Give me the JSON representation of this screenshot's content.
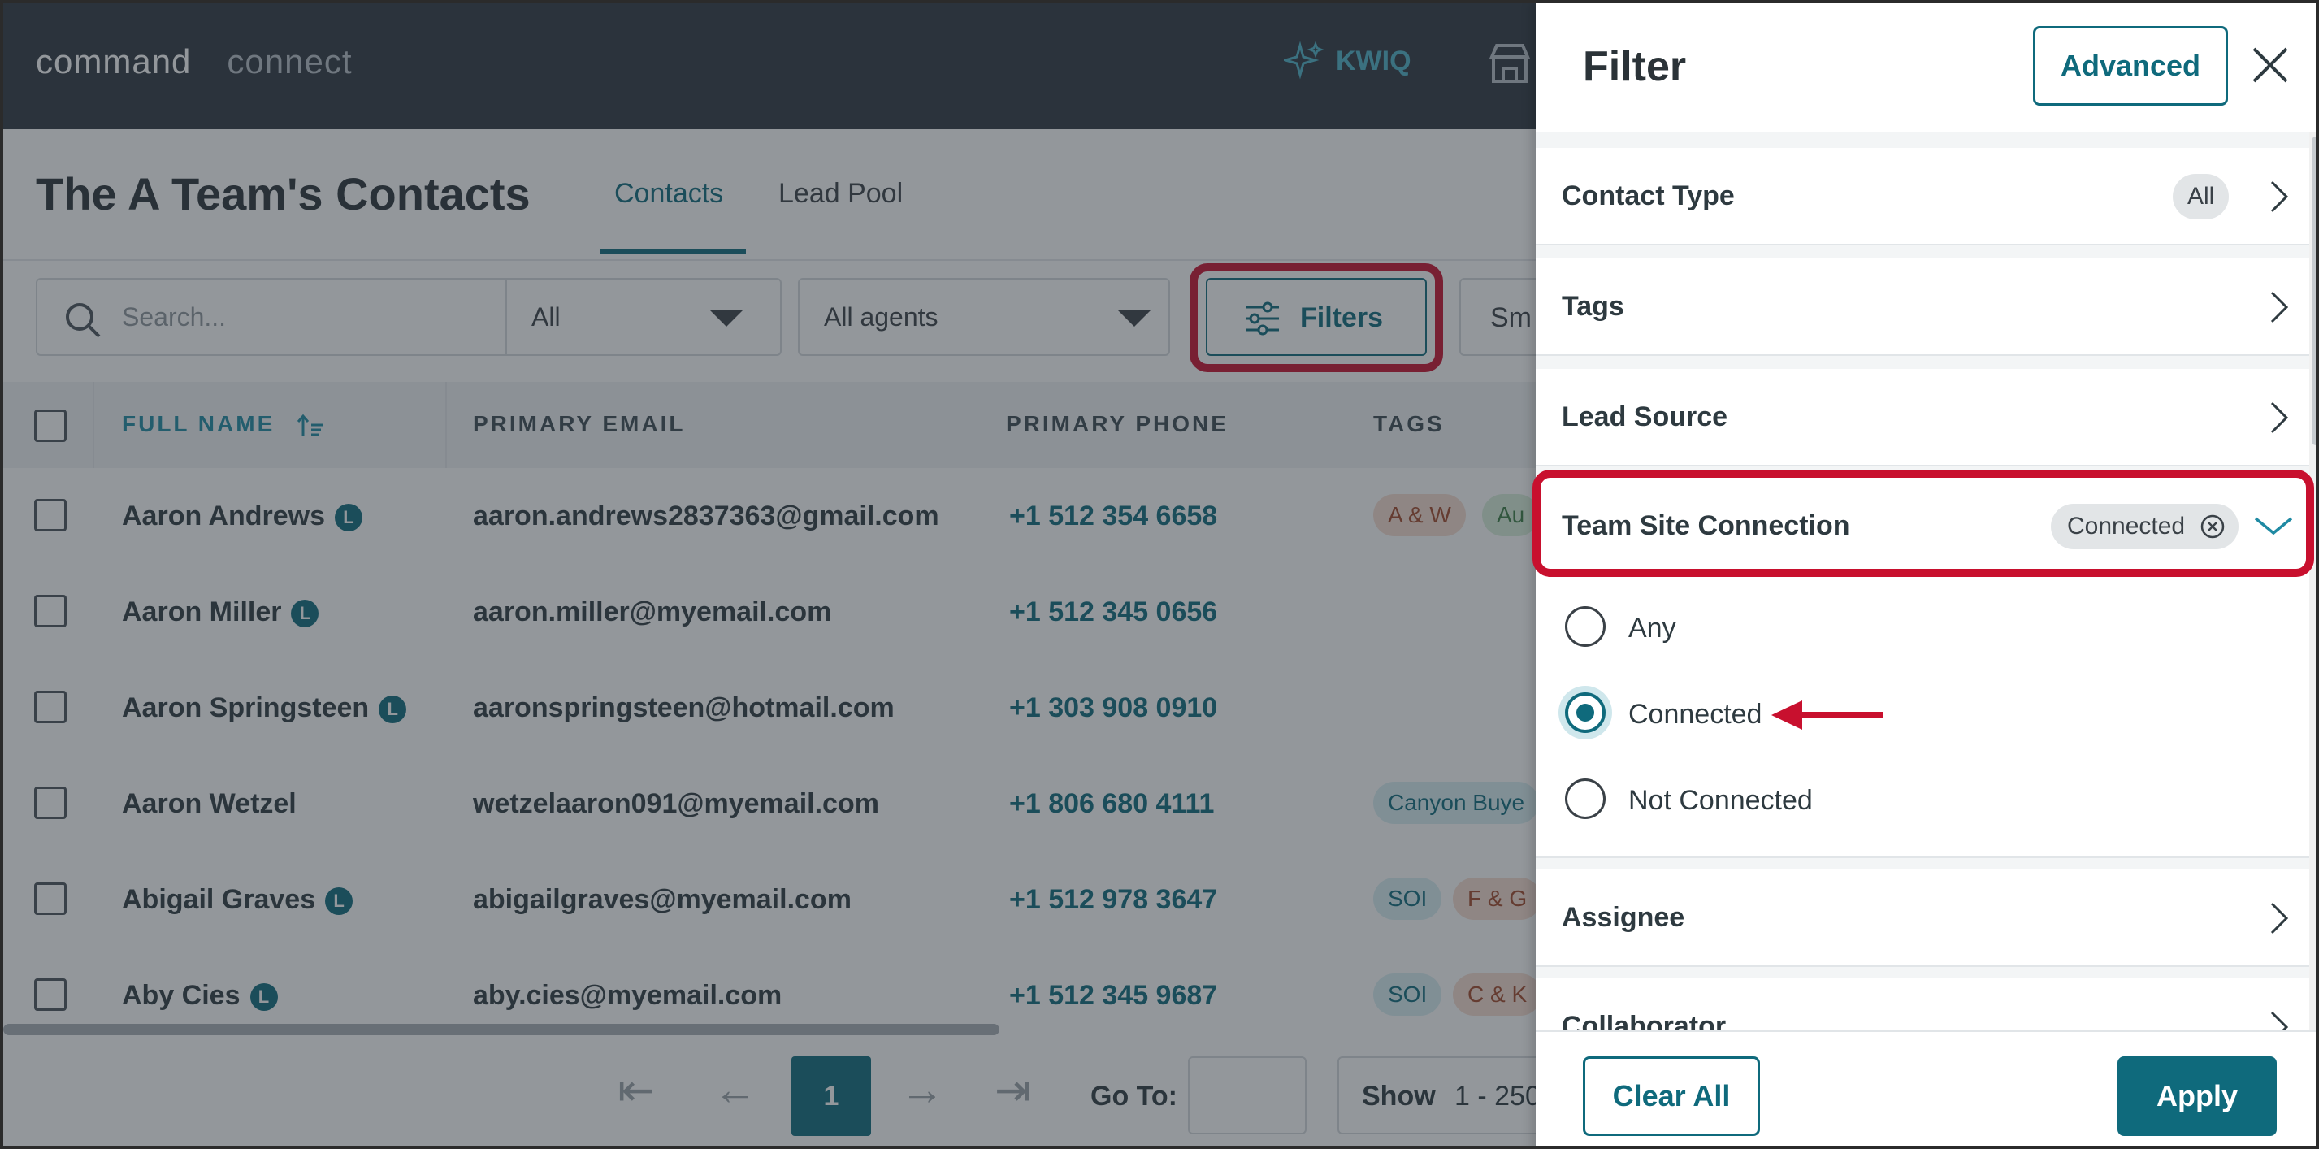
{
  "topbar": {
    "brand_primary": "command",
    "brand_secondary": "connect",
    "kwiq_label": "KWIQ"
  },
  "header": {
    "page_title": "The A Team's Contacts",
    "tabs": [
      {
        "label": "Contacts",
        "active": true
      },
      {
        "label": "Lead Pool",
        "active": false
      }
    ]
  },
  "toolbar": {
    "search_placeholder": "Search...",
    "type_select": "All",
    "agent_select": "All agents",
    "filters_label": "Filters",
    "smart_label": "Sm"
  },
  "table": {
    "headers": [
      "FULL NAME",
      "PRIMARY EMAIL",
      "PRIMARY PHONE",
      "TAGS"
    ],
    "rows": [
      {
        "name": "Aaron Andrews",
        "badge": "L",
        "email": "aaron.andrews2837363@gmail.com",
        "phone": "+1 512 354 6658",
        "tags": [
          {
            "text": "A & W",
            "color": "orange"
          },
          {
            "text": "Au",
            "color": "green"
          }
        ]
      },
      {
        "name": "Aaron Miller",
        "badge": "L",
        "email": "aaron.miller@myemail.com",
        "phone": "+1 512 345 0656",
        "tags": []
      },
      {
        "name": "Aaron Springsteen",
        "badge": "L",
        "email": "aaronspringsteen@hotmail.com",
        "phone": "+1 303 908 0910",
        "tags": []
      },
      {
        "name": "Aaron Wetzel",
        "badge": "",
        "email": "wetzelaaron091@myemail.com",
        "phone": "+1 806 680 4111",
        "tags": [
          {
            "text": "Canyon Buye",
            "color": "blue"
          }
        ]
      },
      {
        "name": "Abigail Graves",
        "badge": "L",
        "email": "abigailgraves@myemail.com",
        "phone": "+1 512 978 3647",
        "tags": [
          {
            "text": "SOI",
            "color": "blue"
          },
          {
            "text": "F & G",
            "color": "orange"
          }
        ]
      },
      {
        "name": "Aby Cies",
        "badge": "L",
        "email": "aby.cies@myemail.com",
        "phone": "+1 512 345 9687",
        "tags": [
          {
            "text": "SOI",
            "color": "blue"
          },
          {
            "text": "C & K",
            "color": "orange"
          }
        ]
      }
    ]
  },
  "pager": {
    "current_page": "1",
    "goto_label": "Go To:",
    "show_label": "Show",
    "range_text": "1 - 250"
  },
  "panel": {
    "title": "Filter",
    "advanced_label": "Advanced",
    "sections": {
      "contact_type": {
        "label": "Contact Type",
        "value": "All"
      },
      "tags": {
        "label": "Tags"
      },
      "lead_source": {
        "label": "Lead Source"
      },
      "team_site_connection": {
        "label": "Team Site Connection",
        "value": "Connected"
      },
      "assignee": {
        "label": "Assignee"
      },
      "collaborator": {
        "label": "Collaborator"
      }
    },
    "options": [
      {
        "label": "Any",
        "selected": false
      },
      {
        "label": "Connected",
        "selected": true
      },
      {
        "label": "Not Connected",
        "selected": false
      }
    ],
    "clear_label": "Clear All",
    "apply_label": "Apply"
  },
  "colors": {
    "accent": "#0f6a7c",
    "highlight": "#c8102e",
    "topbar": "#2e3640"
  }
}
